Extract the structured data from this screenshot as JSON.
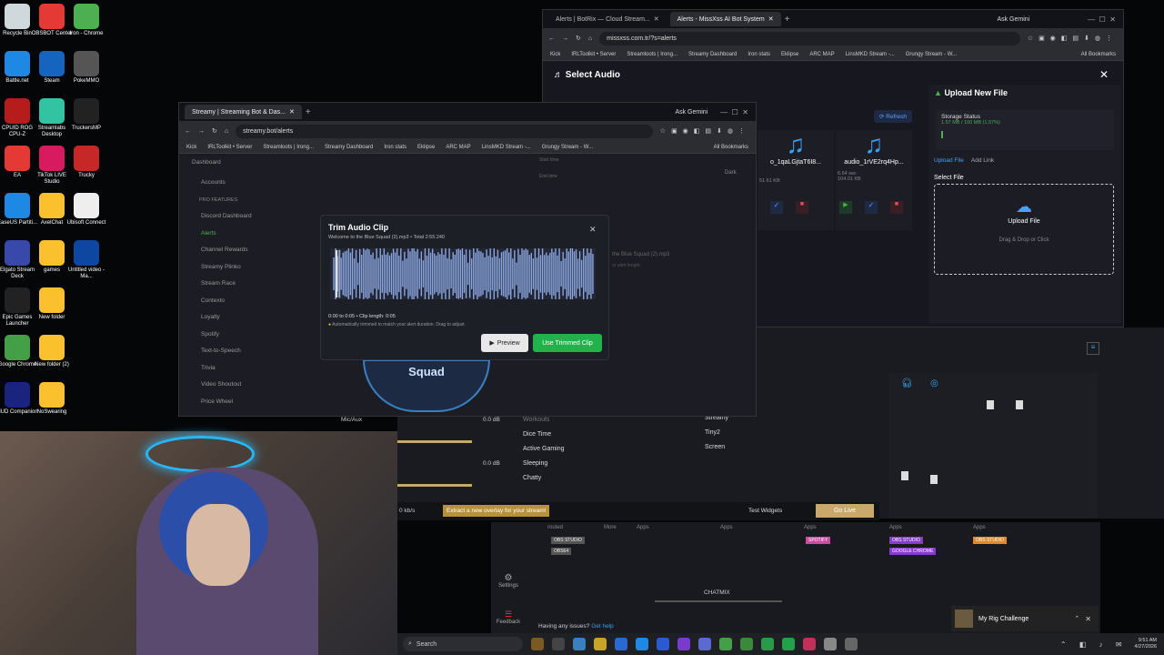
{
  "desktop": {
    "icons": [
      {
        "label": "Recycle Bin",
        "color": "#cfd8dc"
      },
      {
        "label": "OBSBOT Center",
        "color": "#e53935"
      },
      {
        "label": "Iron - Chrome",
        "color": "#4caf50"
      },
      {
        "label": "Battle.net",
        "color": "#1e88e5"
      },
      {
        "label": "Steam",
        "color": "#1565c0"
      },
      {
        "label": "PokeMMO",
        "color": "#555"
      },
      {
        "label": "CPUID ROG CPU-Z",
        "color": "#b71c1c"
      },
      {
        "label": "Streamlabs Desktop",
        "color": "#31c3a2"
      },
      {
        "label": "TruckersMP",
        "color": "#222"
      },
      {
        "label": "EA",
        "color": "#e53935"
      },
      {
        "label": "TikTok LIVE Studio",
        "color": "#d81b60"
      },
      {
        "label": "Trucky",
        "color": "#c62828"
      },
      {
        "label": "EaseUS Partiti...",
        "color": "#1e88e5"
      },
      {
        "label": "AxelChat",
        "color": "#fbc02d"
      },
      {
        "label": "Ubisoft Connect",
        "color": "#eee"
      },
      {
        "label": "Elgato Stream Deck",
        "color": "#3949ab"
      },
      {
        "label": "games",
        "color": "#fbc02d"
      },
      {
        "label": "Untitled video - Ma...",
        "color": "#0d47a1"
      },
      {
        "label": "Epic Games Launcher",
        "color": "#222"
      },
      {
        "label": "New folder",
        "color": "#fbc02d"
      },
      {
        "label": "Google Chrome",
        "color": "#43a047"
      },
      {
        "label": "New folder (2)",
        "color": "#fbc02d"
      },
      {
        "label": "HUD Companion",
        "color": "#1a237e"
      },
      {
        "label": "NoSwearing",
        "color": "#fbc02d"
      }
    ]
  },
  "right_browser": {
    "tabs": [
      "Alerts | BotRix — Cloud Stream...",
      "Alerts - MissXss AI Bot System"
    ],
    "ask_gemini": "Ask Gemini",
    "url": "missxss.com.tr/?s=alerts",
    "bookmarks": [
      "Kick",
      "IRLToolkit • Server",
      "Streamloots | Irong...",
      "Streamy Dashboard",
      "Iron stats",
      "Eklipse",
      "ARC MAP",
      "LinsMKD Stream -...",
      "Grungy Stream - W..."
    ],
    "all_bookmarks": "All Bookmarks",
    "select_audio": "Select Audio",
    "refresh": "Refresh",
    "files": [
      {
        "name": "o_1qaLGjtaT6I8...",
        "meta": "51.61 KB"
      },
      {
        "name": "audio_1rVE2rq4Hp...",
        "meta": "6.64 sec",
        "size": "104.01 KB"
      }
    ],
    "upload_title": "Upload New File",
    "storage_title": "Storage Status",
    "storage_meta": "1.57 MB / 100 MB (1.57%)",
    "upload_file_tab": "Upload File",
    "add_link_tab": "Add Link",
    "select_file": "Select File",
    "upload_file": "Upload File",
    "drag_drop": "Drag & Drop or Click"
  },
  "left_browser": {
    "tab": "Streamy | Streaming Bot & Das...",
    "ask_gemini": "Ask Gemini",
    "url": "streamy.bot/alerts",
    "bookmarks": [
      "Kick",
      "IRLToolkit • Server",
      "Streamloots | Irong...",
      "Streamy Dashboard",
      "Iron stats",
      "Eklipse",
      "ARC MAP",
      "LinsMKD Stream -...",
      "Grungy Stream - W..."
    ],
    "all_bookmarks": "All Bookmarks",
    "sidebar": {
      "top": [
        "Dashboard",
        "Accounts"
      ],
      "section": "PRO FEATURES",
      "items": [
        "Discord Dashboard",
        "Alerts",
        "Channel Rewards",
        "Streamy Plinko",
        "Stream Race",
        "Contexto",
        "Loyalty",
        "Spotify",
        "Text-to-Speech",
        "Trivia",
        "Video Shoutout",
        "Price Wheel"
      ]
    },
    "bg_text": {
      "start_time": "Start time",
      "end_time": "End time",
      "dark": "Dark",
      "bg_file": "the Blue Squad (2).mp3",
      "bg_hint": "or alert length.",
      "squad": "Squad"
    }
  },
  "trim_modal": {
    "title": "Trim Audio Clip",
    "subtitle": "Welcome to the Blue Squad (2).mp3 • Total 2:55.240",
    "time_info": "0:00 to 0:05 • Clip length: 0:05",
    "hint": "Automatically trimmed to match your alert duration. Drag to adjust.",
    "preview": "Preview",
    "use_clip": "Use Trimmed Clip"
  },
  "obs": {
    "mic_aux": "Mic/Aux",
    "db1": "0.0 dB",
    "db2": "0.0 dB",
    "scenes": [
      "Workouts",
      "Dice Time",
      "Active Gaming",
      "Sleeping",
      "Chatty"
    ],
    "sources": [
      "Streamy",
      "Tiny2",
      "Screen"
    ],
    "kbps": "0 kb/s",
    "overlay_prompt": "Extract a new overlay for your stream!",
    "test_widgets": "Test Widgets",
    "go_live": "Go Live"
  },
  "mixer": {
    "routed": "routed",
    "more": "More",
    "apps": "Apps",
    "badges": [
      "OBS STUDIO",
      "OBS64",
      "SPOTIFY",
      "OBS STUDIO",
      "GOOGLE CHROME",
      "OBS STUDIO"
    ],
    "chatmix": "CHATMIX",
    "settings": "Settings",
    "feedback": "Feedback",
    "issues": "Having any issues?",
    "get_help": "Get help"
  },
  "notification": {
    "title": "My Rig Challenge"
  },
  "taskbar": {
    "search": "Search",
    "time": "9:51 AM",
    "date": "4/27/2026"
  }
}
